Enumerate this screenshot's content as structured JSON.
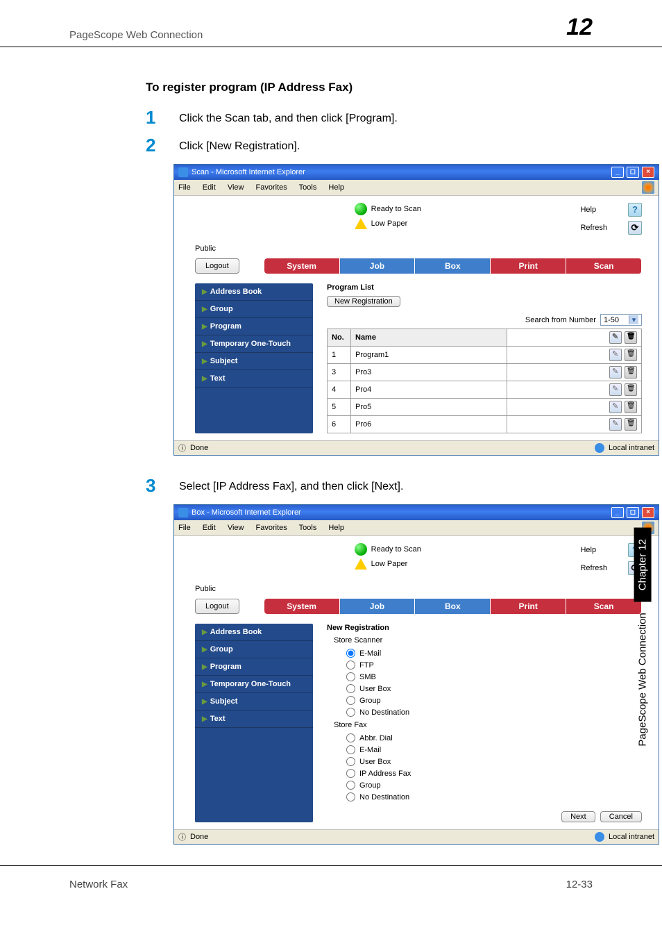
{
  "header": {
    "left": "PageScope Web Connection",
    "right": "12"
  },
  "section_title": "To register program (IP Address Fax)",
  "steps": {
    "s1": {
      "num": "1",
      "text": "Click the Scan tab, and then click [Program]."
    },
    "s2": {
      "num": "2",
      "text": "Click [New Registration]."
    },
    "s3": {
      "num": "3",
      "text": "Select [IP Address Fax], and then click [Next]."
    }
  },
  "ie_common": {
    "menus": [
      "File",
      "Edit",
      "View",
      "Favorites",
      "Tools",
      "Help"
    ],
    "status_ready": "Ready to Scan",
    "status_lowpaper": "Low Paper",
    "help": "Help",
    "refresh": "Refresh",
    "public": "Public",
    "logout": "Logout",
    "tabs": {
      "system": "System",
      "job": "Job",
      "box": "Box",
      "print": "Print",
      "scan": "Scan"
    },
    "sidebar": [
      "Address Book",
      "Group",
      "Program",
      "Temporary One-Touch",
      "Subject",
      "Text"
    ],
    "status_done": "Done",
    "status_zone": "Local intranet"
  },
  "window1": {
    "title": "Scan - Microsoft Internet Explorer",
    "list_title": "Program List",
    "new_reg_btn": "New Registration",
    "search_label": "Search from Number",
    "search_range": "1-50",
    "columns": {
      "no": "No.",
      "name": "Name"
    },
    "rows": [
      {
        "no": "1",
        "name": "Program1"
      },
      {
        "no": "3",
        "name": "Pro3"
      },
      {
        "no": "4",
        "name": "Pro4"
      },
      {
        "no": "5",
        "name": "Pro5"
      },
      {
        "no": "6",
        "name": "Pro6"
      }
    ]
  },
  "window2": {
    "title": "Box - Microsoft Internet Explorer",
    "form_title": "New Registration",
    "group1": "Store Scanner",
    "group1_opts": [
      "E-Mail",
      "FTP",
      "SMB",
      "User Box",
      "Group",
      "No Destination"
    ],
    "group2": "Store Fax",
    "group2_opts": [
      "Abbr. Dial",
      "E-Mail",
      "User Box",
      "IP Address Fax",
      "Group",
      "No Destination"
    ],
    "next": "Next",
    "cancel": "Cancel"
  },
  "footer": {
    "left": "Network Fax",
    "right": "12-33"
  },
  "side": {
    "txt": "PageScope Web Connection",
    "chap": "Chapter 12"
  }
}
